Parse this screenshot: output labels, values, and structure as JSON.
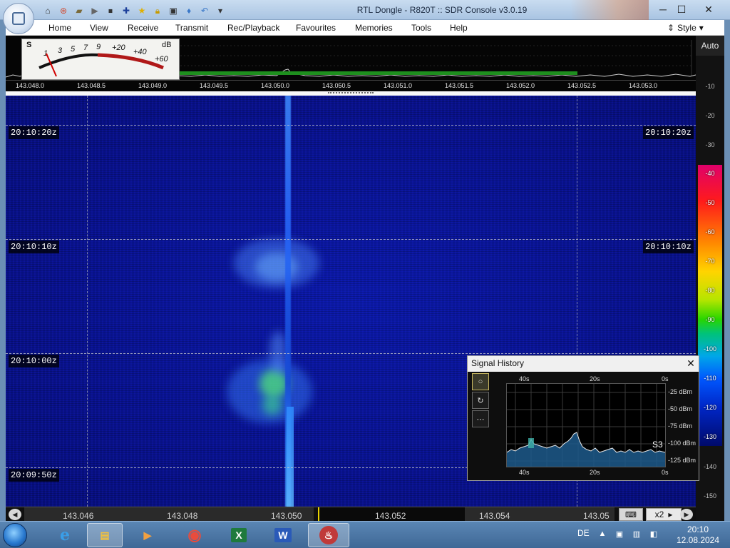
{
  "window": {
    "title": "RTL Dongle - R820T :: SDR Console v3.0.19",
    "minimize": "─",
    "maximize": "☐",
    "close": "✕"
  },
  "menu": {
    "items": [
      "Home",
      "View",
      "Receive",
      "Transmit",
      "Rec/Playback",
      "Favourites",
      "Memories",
      "Tools",
      "Help"
    ],
    "style_label": "Style"
  },
  "smeter": {
    "s_label": "S",
    "db_label": "dB",
    "s_scale": [
      "1",
      "3",
      "5",
      "7",
      "9"
    ],
    "db_scale": [
      "+20",
      "+40",
      "+60"
    ]
  },
  "spectrum": {
    "auto_label": "Auto",
    "freq_ticks": [
      "143.048.0",
      "143.048.5",
      "143.049.0",
      "143.049.5",
      "143.050.0",
      "143.050.5",
      "143.051.0",
      "143.051.5",
      "143.052.0",
      "143.052.5",
      "143.053.0"
    ]
  },
  "db_scale": {
    "gray_ticks": [
      "-10",
      "-20",
      "-30"
    ],
    "color_ticks": [
      "-40",
      "-50",
      "-60",
      "-70",
      "-80",
      "-90",
      "-100",
      "-110",
      "-120",
      "-130"
    ],
    "lower_ticks": [
      "-140",
      "-150"
    ]
  },
  "waterfall": {
    "time_labels": [
      "20:10:20z",
      "20:10:10z",
      "20:10:00z",
      "20:09:50z"
    ]
  },
  "band": {
    "labels": [
      "143.046",
      "143.048",
      "143.050",
      "143.052",
      "143.054",
      "143.05"
    ],
    "zoom": "x2"
  },
  "signal_history": {
    "title": "Signal History",
    "close": "✕",
    "x_labels": [
      "40s",
      "20s",
      "0s"
    ],
    "y_labels": [
      "-25 dBm",
      "-50 dBm",
      "-75 dBm",
      "-100 dBm",
      "-125 dBm"
    ],
    "s_reading": "S3",
    "side_buttons": [
      "○",
      "↻",
      "⋯"
    ]
  },
  "taskbar": {
    "apps": [
      {
        "name": "internet-explorer",
        "glyph": "e"
      },
      {
        "name": "file-explorer",
        "glyph": "▤"
      },
      {
        "name": "media-player",
        "glyph": "▶"
      },
      {
        "name": "chrome",
        "glyph": "◉"
      },
      {
        "name": "excel",
        "glyph": "X"
      },
      {
        "name": "word",
        "glyph": "W"
      },
      {
        "name": "sdr-console",
        "glyph": "♨"
      }
    ],
    "language": "DE",
    "time": "20:10",
    "date": "12.08.2024"
  },
  "colors": {
    "waterfall_bg": "#08128c",
    "carrier": "#2a6cff",
    "spectrum_green": "#1e8f1e",
    "taskbar": "#4a74a4"
  }
}
